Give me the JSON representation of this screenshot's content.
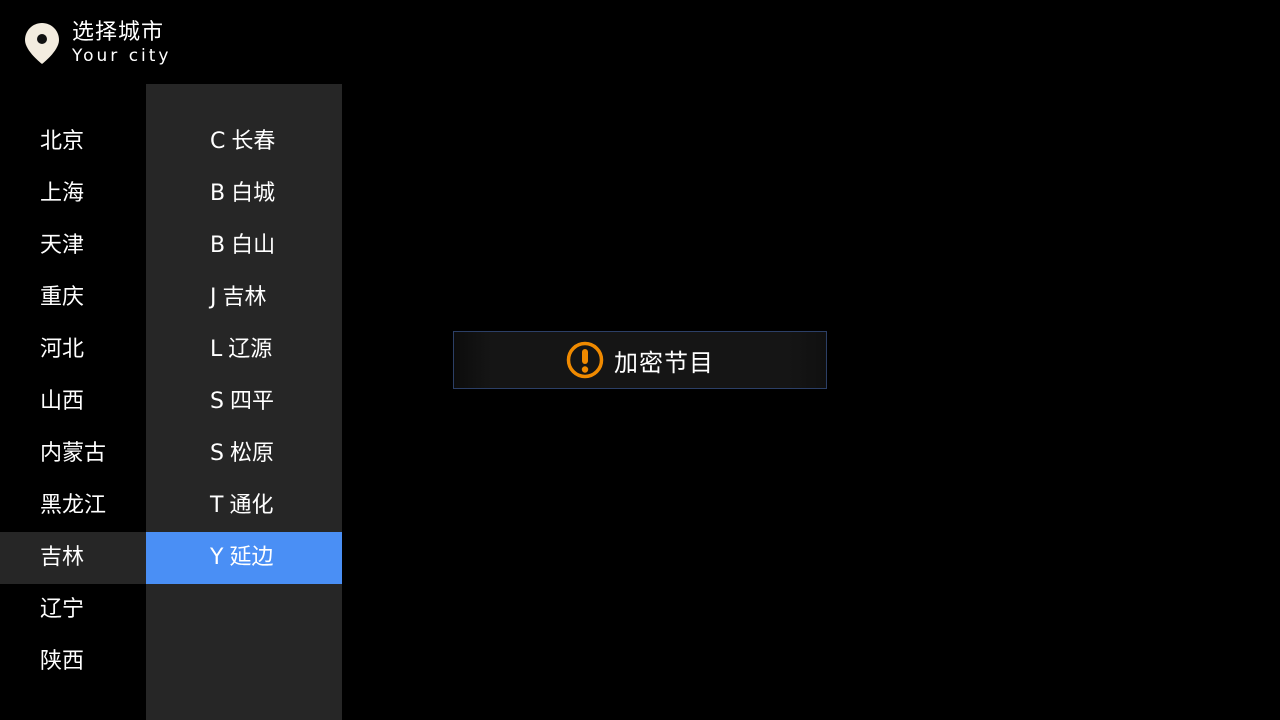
{
  "header": {
    "title": "选择城市",
    "subtitle": "Your city",
    "icon": "location-pin-icon"
  },
  "provinces": [
    {
      "label": "北京",
      "selected": false
    },
    {
      "label": "上海",
      "selected": false
    },
    {
      "label": "天津",
      "selected": false
    },
    {
      "label": "重庆",
      "selected": false
    },
    {
      "label": "河北",
      "selected": false
    },
    {
      "label": "山西",
      "selected": false
    },
    {
      "label": "内蒙古",
      "selected": false
    },
    {
      "label": "黑龙江",
      "selected": false
    },
    {
      "label": "吉林",
      "selected": true
    },
    {
      "label": "辽宁",
      "selected": false
    },
    {
      "label": "陕西",
      "selected": false
    }
  ],
  "cities": [
    {
      "letter": "C",
      "name": "长春",
      "focused": false
    },
    {
      "letter": "B",
      "name": "白城",
      "focused": false
    },
    {
      "letter": "B",
      "name": "白山",
      "focused": false
    },
    {
      "letter": "J",
      "name": "吉林",
      "focused": false
    },
    {
      "letter": "L",
      "name": "辽源",
      "focused": false
    },
    {
      "letter": "S",
      "name": "四平",
      "focused": false
    },
    {
      "letter": "S",
      "name": "松原",
      "focused": false
    },
    {
      "letter": "T",
      "name": "通化",
      "focused": false
    },
    {
      "letter": "Y",
      "name": "延边",
      "focused": true
    }
  ],
  "notice": {
    "text": "加密节目",
    "icon": "warning-icon"
  },
  "colors": {
    "background": "#000000",
    "panel": "#262626",
    "focus": "#4a8ff5",
    "warning": "#f08a00",
    "pin": "#f3ecdf"
  }
}
